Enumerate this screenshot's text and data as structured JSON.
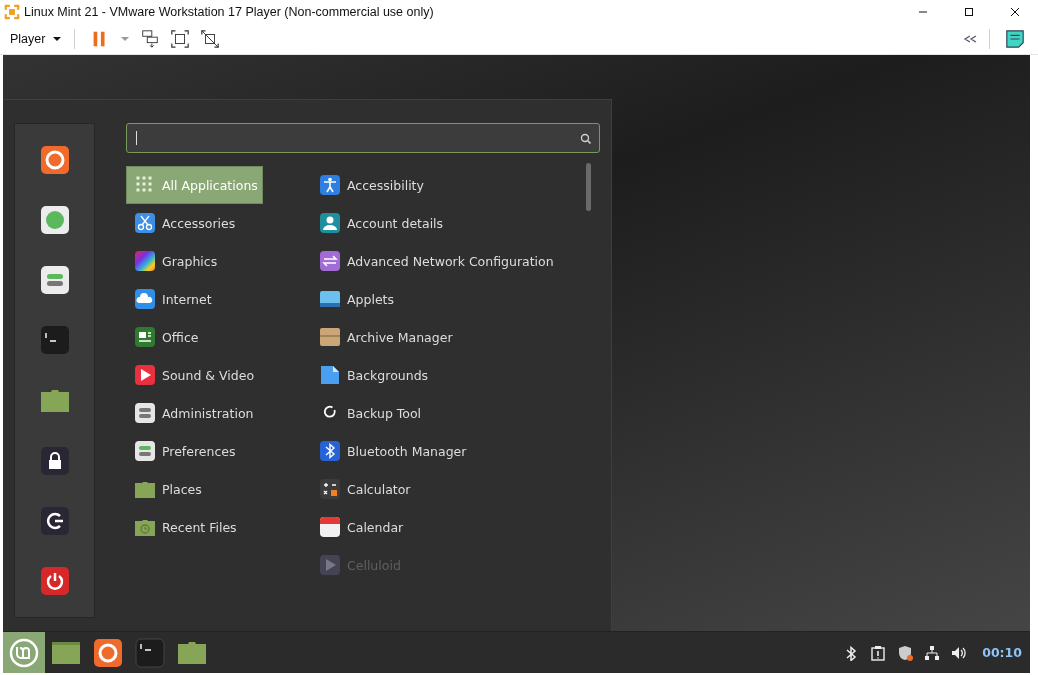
{
  "window": {
    "title": "Linux Mint 21 - VMware Workstation 17 Player (Non-commercial use only)"
  },
  "toolbar": {
    "player_menu": "Player"
  },
  "categories": [
    {
      "label": "All Applications",
      "selected": true
    },
    {
      "label": "Accessories",
      "selected": false
    },
    {
      "label": "Graphics",
      "selected": false
    },
    {
      "label": "Internet",
      "selected": false
    },
    {
      "label": "Office",
      "selected": false
    },
    {
      "label": "Sound & Video",
      "selected": false
    },
    {
      "label": "Administration",
      "selected": false
    },
    {
      "label": "Preferences",
      "selected": false
    },
    {
      "label": "Places",
      "selected": false
    },
    {
      "label": "Recent Files",
      "selected": false
    }
  ],
  "applications": [
    {
      "label": "Accessibility",
      "disabled": false
    },
    {
      "label": "Account details",
      "disabled": false
    },
    {
      "label": "Advanced Network Configuration",
      "disabled": false
    },
    {
      "label": "Applets",
      "disabled": false
    },
    {
      "label": "Archive Manager",
      "disabled": false
    },
    {
      "label": "Backgrounds",
      "disabled": false
    },
    {
      "label": "Backup Tool",
      "disabled": false
    },
    {
      "label": "Bluetooth Manager",
      "disabled": false
    },
    {
      "label": "Calculator",
      "disabled": false
    },
    {
      "label": "Calendar",
      "disabled": false
    },
    {
      "label": "Celluloid",
      "disabled": true
    }
  ],
  "taskbar": {
    "clock": "00:10"
  }
}
